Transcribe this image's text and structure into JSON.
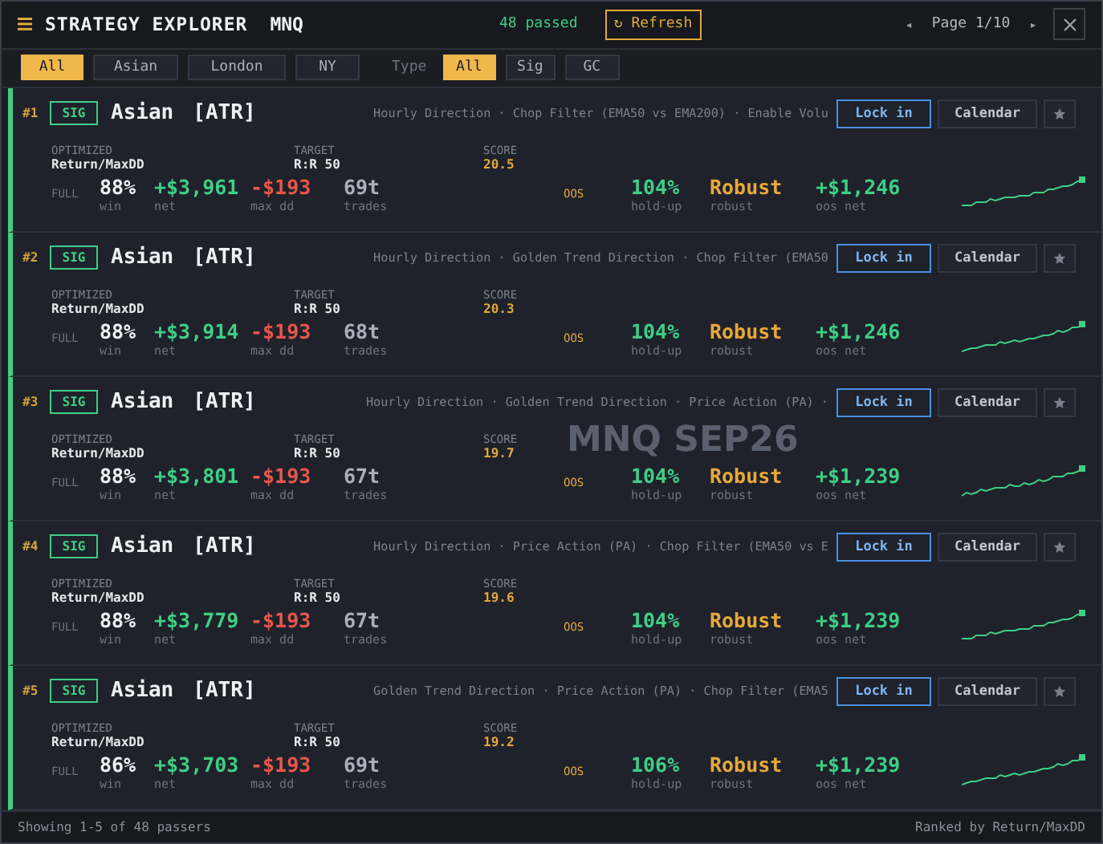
{
  "header": {
    "title": "STRATEGY EXPLORER",
    "symbol": "MNQ",
    "passed": "48 passed",
    "refresh": "↻ Refresh",
    "prev": "◂",
    "page": "Page 1/10",
    "next": "▸"
  },
  "sessions": [
    {
      "label": "All",
      "selected": true
    },
    {
      "label": "Asian",
      "selected": false
    },
    {
      "label": "London",
      "selected": false
    },
    {
      "label": "NY",
      "selected": false
    }
  ],
  "type_label": "Type",
  "types": [
    {
      "label": "All",
      "selected": true
    },
    {
      "label": "Sig",
      "selected": false
    },
    {
      "label": "GC",
      "selected": false
    }
  ],
  "watermark": "MNQ SEP26",
  "strategies": [
    {
      "rank": "#1",
      "badge": "SIG",
      "session": "Asian",
      "tag": "[ATR]",
      "filters": "Hourly Direction · Chop Filter (EMA50 vs EMA200) · Enable Volu",
      "optimized_label": "OPTIMIZED",
      "optimized": "Return/MaxDD",
      "target_label": "TARGET",
      "target": "R:R 50",
      "score_label": "SCORE",
      "score": "20.5",
      "full_label": "FULL",
      "full": [
        {
          "value": "88%",
          "label": "win"
        },
        {
          "value": "+$3,961",
          "label": "net"
        },
        {
          "value": "-$193",
          "label": "max dd"
        },
        {
          "value": "69t",
          "label": "trades"
        }
      ],
      "oos_label": "OOS",
      "oos": [
        {
          "value": "104%",
          "label": "hold-up"
        },
        {
          "value": "Robust",
          "label": "robust"
        },
        {
          "value": "+$1,246",
          "label": "oos net"
        }
      ],
      "actions": [
        "Lock in",
        "Calendar"
      ]
    },
    {
      "rank": "#2",
      "badge": "SIG",
      "session": "Asian",
      "tag": "[ATR]",
      "filters": "Hourly Direction · Golden Trend Direction · Chop Filter (EMA50",
      "optimized_label": "OPTIMIZED",
      "optimized": "Return/MaxDD",
      "target_label": "TARGET",
      "target": "R:R 50",
      "score_label": "SCORE",
      "score": "20.3",
      "full_label": "FULL",
      "full": [
        {
          "value": "88%",
          "label": "win"
        },
        {
          "value": "+$3,914",
          "label": "net"
        },
        {
          "value": "-$193",
          "label": "max dd"
        },
        {
          "value": "68t",
          "label": "trades"
        }
      ],
      "oos_label": "OOS",
      "oos": [
        {
          "value": "104%",
          "label": "hold-up"
        },
        {
          "value": "Robust",
          "label": "robust"
        },
        {
          "value": "+$1,246",
          "label": "oos net"
        }
      ],
      "actions": [
        "Lock in",
        "Calendar"
      ]
    },
    {
      "rank": "#3",
      "badge": "SIG",
      "session": "Asian",
      "tag": "[ATR]",
      "filters": "Hourly Direction · Golden Trend Direction · Price Action (PA) ·",
      "optimized_label": "OPTIMIZED",
      "optimized": "Return/MaxDD",
      "target_label": "TARGET",
      "target": "R:R 50",
      "score_label": "SCORE",
      "score": "19.7",
      "full_label": "FULL",
      "full": [
        {
          "value": "88%",
          "label": "win"
        },
        {
          "value": "+$3,801",
          "label": "net"
        },
        {
          "value": "-$193",
          "label": "max dd"
        },
        {
          "value": "67t",
          "label": "trades"
        }
      ],
      "oos_label": "OOS",
      "oos": [
        {
          "value": "104%",
          "label": "hold-up"
        },
        {
          "value": "Robust",
          "label": "robust"
        },
        {
          "value": "+$1,239",
          "label": "oos net"
        }
      ],
      "actions": [
        "Lock in",
        "Calendar"
      ]
    },
    {
      "rank": "#4",
      "badge": "SIG",
      "session": "Asian",
      "tag": "[ATR]",
      "filters": "Hourly Direction · Price Action (PA) · Chop Filter (EMA50 vs E",
      "optimized_label": "OPTIMIZED",
      "optimized": "Return/MaxDD",
      "target_label": "TARGET",
      "target": "R:R 50",
      "score_label": "SCORE",
      "score": "19.6",
      "full_label": "FULL",
      "full": [
        {
          "value": "88%",
          "label": "win"
        },
        {
          "value": "+$3,779",
          "label": "net"
        },
        {
          "value": "-$193",
          "label": "max dd"
        },
        {
          "value": "67t",
          "label": "trades"
        }
      ],
      "oos_label": "OOS",
      "oos": [
        {
          "value": "104%",
          "label": "hold-up"
        },
        {
          "value": "Robust",
          "label": "robust"
        },
        {
          "value": "+$1,239",
          "label": "oos net"
        }
      ],
      "actions": [
        "Lock in",
        "Calendar"
      ]
    },
    {
      "rank": "#5",
      "badge": "SIG",
      "session": "Asian",
      "tag": "[ATR]",
      "filters": "Golden Trend Direction · Price Action (PA) · Chop Filter (EMA5",
      "optimized_label": "OPTIMIZED",
      "optimized": "Return/MaxDD",
      "target_label": "TARGET",
      "target": "R:R 50",
      "score_label": "SCORE",
      "score": "19.2",
      "full_label": "FULL",
      "full": [
        {
          "value": "86%",
          "label": "win"
        },
        {
          "value": "+$3,703",
          "label": "net"
        },
        {
          "value": "-$193",
          "label": "max dd"
        },
        {
          "value": "69t",
          "label": "trades"
        }
      ],
      "oos_label": "OOS",
      "oos": [
        {
          "value": "106%",
          "label": "hold-up"
        },
        {
          "value": "Robust",
          "label": "robust"
        },
        {
          "value": "+$1,239",
          "label": "oos net"
        }
      ],
      "actions": [
        "Lock in",
        "Calendar"
      ]
    }
  ],
  "footer": {
    "showing": "Showing 1-5 of 48 passers",
    "ranked": "Ranked by Return/MaxDD"
  }
}
